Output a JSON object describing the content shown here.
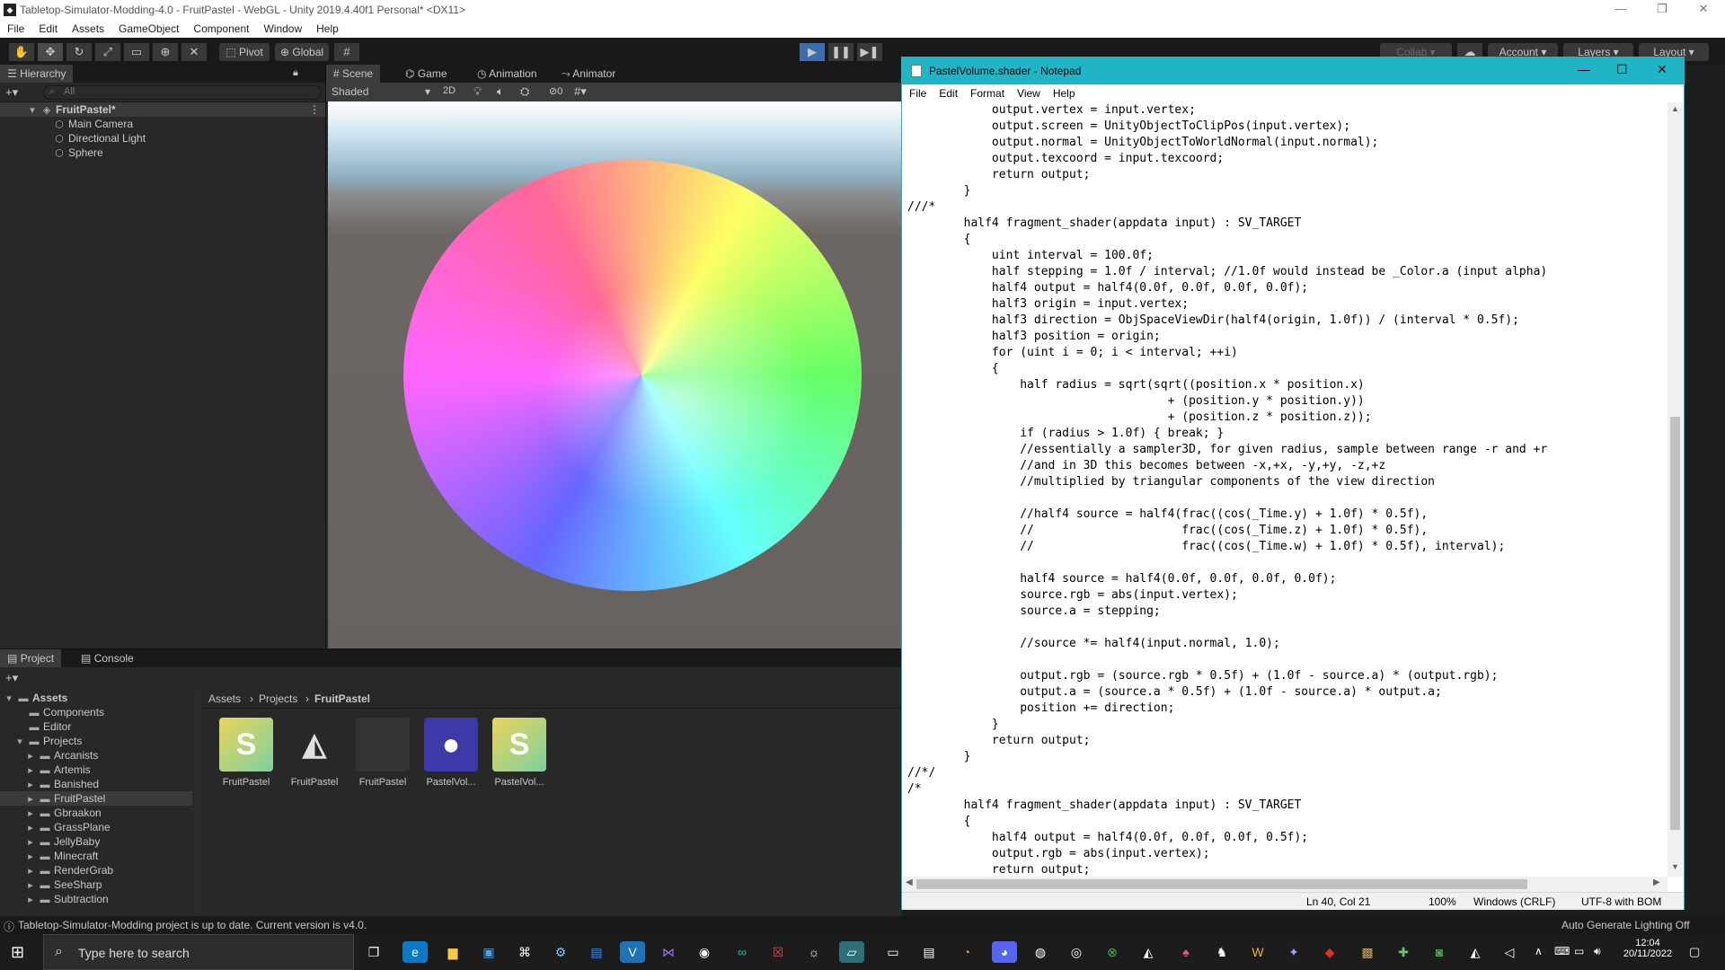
{
  "unity": {
    "window_title": "Tabletop-Simulator-Modding-4.0 - FruitPastel - WebGL - Unity 2019.4.40f1 Personal* <DX11>",
    "menu": [
      "File",
      "Edit",
      "Assets",
      "GameObject",
      "Component",
      "Window",
      "Help"
    ],
    "toolbar": {
      "pivot_label": "Pivot",
      "global_label": "Global",
      "collab_label": "Collab",
      "account_label": "Account",
      "layers_label": "Layers",
      "layout_label": "Layout"
    },
    "hierarchy": {
      "tab_label": "Hierarchy",
      "search_placeholder": "All",
      "scene_name": "FruitPastel*",
      "objects": [
        "Main Camera",
        "Directional Light",
        "Sphere"
      ]
    },
    "scene_tabs": {
      "scene": "Scene",
      "game": "Game",
      "animation": "Animation",
      "animator": "Animator",
      "shading_mode": "Shaded",
      "mode_2d": "2D",
      "hidden_count": "0"
    },
    "project": {
      "tab_project": "Project",
      "tab_console": "Console",
      "breadcrumb": [
        "Assets",
        "Projects",
        "FruitPastel"
      ],
      "tree_root": "Assets",
      "tree": [
        {
          "label": "Components",
          "indent": 1
        },
        {
          "label": "Editor",
          "indent": 1
        },
        {
          "label": "Projects",
          "indent": 1
        },
        {
          "label": "Arcanists",
          "indent": 2
        },
        {
          "label": "Artemis",
          "indent": 2
        },
        {
          "label": "Banished",
          "indent": 2
        },
        {
          "label": "FruitPastel",
          "indent": 2,
          "selected": true
        },
        {
          "label": "Gbraakon",
          "indent": 2
        },
        {
          "label": "GrassPlane",
          "indent": 2
        },
        {
          "label": "JellyBaby",
          "indent": 2
        },
        {
          "label": "Minecraft",
          "indent": 2
        },
        {
          "label": "RenderGrab",
          "indent": 2
        },
        {
          "label": "SeeSharp",
          "indent": 2
        },
        {
          "label": "Subtraction",
          "indent": 2
        }
      ],
      "assets": [
        {
          "label": "FruitPastel",
          "kind": "shader"
        },
        {
          "label": "FruitPastel",
          "kind": "unity"
        },
        {
          "label": "FruitPastel",
          "kind": "material"
        },
        {
          "label": "PastelVol...",
          "kind": "prefab"
        },
        {
          "label": "PastelVol...",
          "kind": "shader"
        }
      ]
    },
    "status_bar": {
      "message": "Tabletop-Simulator-Modding project is up to date. Current version is v4.0.",
      "right": "Auto Generate Lighting Off"
    }
  },
  "notepad": {
    "title": "PastelVolume.shader - Notepad",
    "menu": [
      "File",
      "Edit",
      "Format",
      "View",
      "Help"
    ],
    "lines": [
      "            output.vertex = input.vertex;",
      "            output.screen = UnityObjectToClipPos(input.vertex);",
      "            output.normal = UnityObjectToWorldNormal(input.normal);",
      "            output.texcoord = input.texcoord;",
      "            return output;",
      "        }",
      "///*",
      "        half4 fragment_shader(appdata input) : SV_TARGET",
      "        {",
      "            uint interval = 100.0f;",
      "            half stepping = 1.0f / interval; //1.0f would instead be _Color.a (input alpha)",
      "            half4 output = half4(0.0f, 0.0f, 0.0f, 0.0f);",
      "            half3 origin = input.vertex;",
      "            half3 direction = ObjSpaceViewDir(half4(origin, 1.0f)) / (interval * 0.5f);",
      "            half3 position = origin;",
      "            for (uint i = 0; i < interval; ++i)",
      "            {",
      "                half radius = sqrt(sqrt((position.x * position.x)",
      "                                     + (position.y * position.y))",
      "                                     + (position.z * position.z));",
      "                if (radius > 1.0f) { break; }",
      "                //essentially a sampler3D, for given radius, sample between range -r and +r",
      "                //and in 3D this becomes between -x,+x, -y,+y, -z,+z",
      "                //multiplied by triangular components of the view direction",
      "",
      "                //half4 source = half4(frac((cos(_Time.y) + 1.0f) * 0.5f),",
      "                //                     frac((cos(_Time.z) + 1.0f) * 0.5f),",
      "                //                     frac((cos(_Time.w) + 1.0f) * 0.5f), interval);",
      "",
      "                half4 source = half4(0.0f, 0.0f, 0.0f, 0.0f);",
      "                source.rgb = abs(input.vertex);",
      "                source.a = stepping;",
      "",
      "                //source *= half4(input.normal, 1.0);",
      "",
      "                output.rgb = (source.rgb * 0.5f) + (1.0f - source.a) * (output.rgb);",
      "                output.a = (source.a * 0.5f) + (1.0f - source.a) * output.a;",
      "                position += direction;",
      "            }",
      "            return output;",
      "        }",
      "//*/",
      "/*",
      "        half4 fragment_shader(appdata input) : SV_TARGET",
      "        {",
      "            half4 output = half4(0.0f, 0.0f, 0.0f, 0.5f);",
      "            output.rgb = abs(input.vertex);",
      "            return output;"
    ],
    "status": {
      "position": "Ln 40, Col 21",
      "zoom": "100%",
      "line_ending": "Windows (CRLF)",
      "encoding": "UTF-8 with BOM"
    }
  },
  "taskbar": {
    "search_placeholder": "Type here to search",
    "time": "12:04",
    "date": "20/11/2022"
  }
}
